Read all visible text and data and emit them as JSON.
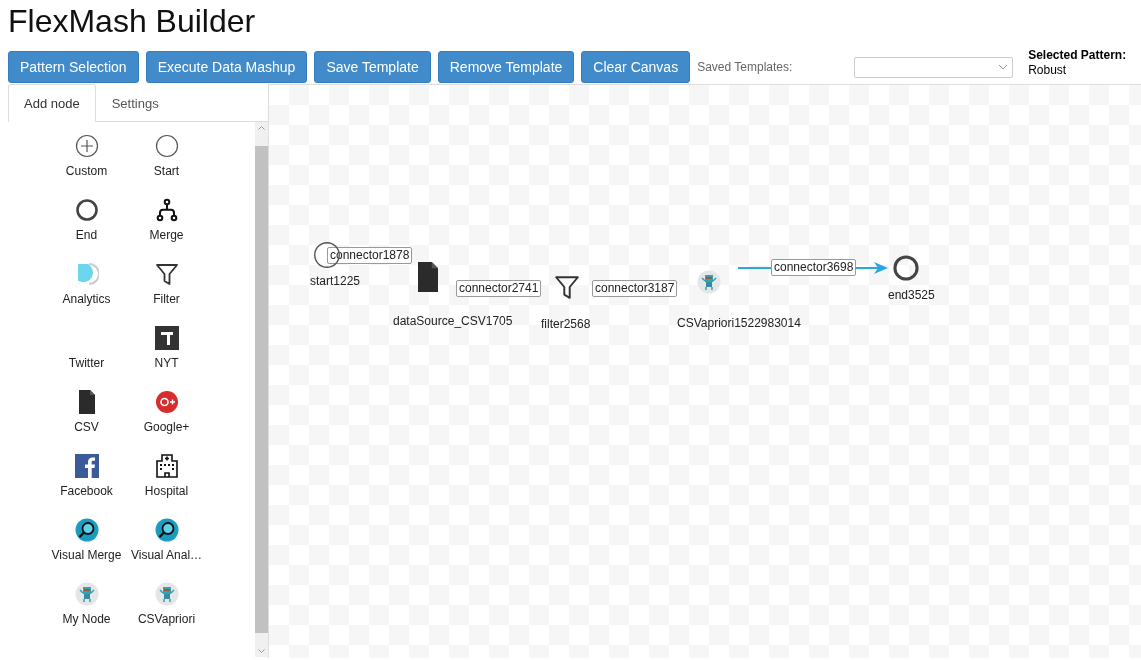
{
  "app": {
    "title": "FlexMash Builder"
  },
  "toolbar": {
    "buttons": [
      "Pattern Selection",
      "Execute Data Mashup",
      "Save Template",
      "Remove Template",
      "Clear Canvas"
    ],
    "saved_templates": {
      "label": "Saved Templates:"
    },
    "selected_pattern": {
      "label": "Selected Pattern:",
      "value": "Robust"
    }
  },
  "sidebar": {
    "tabs": [
      {
        "label": "Add node",
        "selected": true
      },
      {
        "label": "Settings",
        "selected": false
      }
    ],
    "palette": [
      {
        "label": "Custom",
        "kind": "plus"
      },
      {
        "label": "Start",
        "kind": "start"
      },
      {
        "label": "End",
        "kind": "end"
      },
      {
        "label": "Merge",
        "kind": "merge"
      },
      {
        "label": "Analytics",
        "kind": "analytics"
      },
      {
        "label": "Filter",
        "kind": "filter"
      },
      {
        "label": "Twitter",
        "kind": "blank"
      },
      {
        "label": "NYT",
        "kind": "newspaper"
      },
      {
        "label": "CSV",
        "kind": "csv"
      },
      {
        "label": "Google+",
        "kind": "gplus"
      },
      {
        "label": "Facebook",
        "kind": "facebook"
      },
      {
        "label": "Hospital",
        "kind": "hospital"
      },
      {
        "label": "Visual Merge",
        "kind": "magnifier"
      },
      {
        "label": "Visual Anal…",
        "kind": "magnifier"
      },
      {
        "label": "My Node",
        "kind": "robot"
      },
      {
        "label": "CSVapriori",
        "kind": "robot"
      }
    ]
  },
  "canvas": {
    "nodes": [
      {
        "label": "start1225",
        "kind": "start"
      },
      {
        "label": "dataSource_CSV1705",
        "kind": "csv"
      },
      {
        "label": "filter2568",
        "kind": "filter"
      },
      {
        "label": "CSVapriori1522983014",
        "kind": "robot"
      },
      {
        "label": "end3525",
        "kind": "end"
      }
    ],
    "connectors": [
      {
        "label": "connector1878",
        "highlighted": false
      },
      {
        "label": "connector2741",
        "highlighted": false
      },
      {
        "label": "connector3187",
        "highlighted": false
      },
      {
        "label": "connector3698",
        "highlighted": true
      }
    ]
  }
}
